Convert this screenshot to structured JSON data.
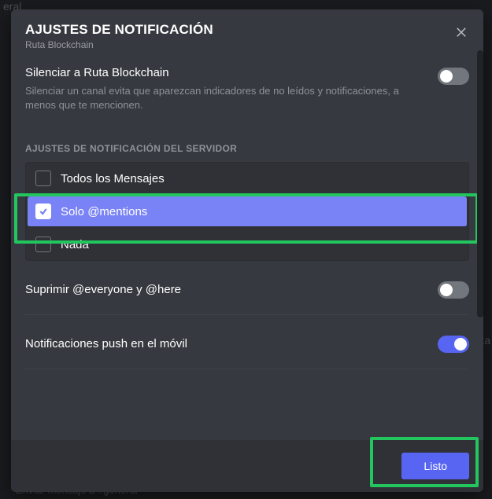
{
  "modal": {
    "title": "AJUSTES DE NOTIFICACIÓN",
    "subtitle": "Ruta Blockchain",
    "close_icon": "close-icon"
  },
  "mute": {
    "title": "Silenciar a Ruta Blockchain",
    "description": "Silenciar un canal evita que aparezcan indicadores de no leídos y notificaciones, a menos que te mencionen.",
    "enabled": false
  },
  "server_section_label": "AJUSTES DE NOTIFICACIÓN DEL SERVIDOR",
  "radio_options": [
    {
      "label": "Todos los Mensajes",
      "selected": false
    },
    {
      "label": "Solo @mentions",
      "selected": true
    },
    {
      "label": "Nada",
      "selected": false
    }
  ],
  "suppress": {
    "title": "Suprimir @everyone y @here",
    "enabled": false
  },
  "push": {
    "title": "Notificaciones push en el móvil",
    "enabled": true
  },
  "footer": {
    "done_label": "Listo"
  },
  "colors": {
    "accent": "#5865f2",
    "highlight": "#22c55e",
    "modal_bg": "#36393f"
  },
  "background_hints": {
    "top_left": "eral",
    "right_mid": "eta",
    "bottom": "Enviar mensaje a #general"
  }
}
